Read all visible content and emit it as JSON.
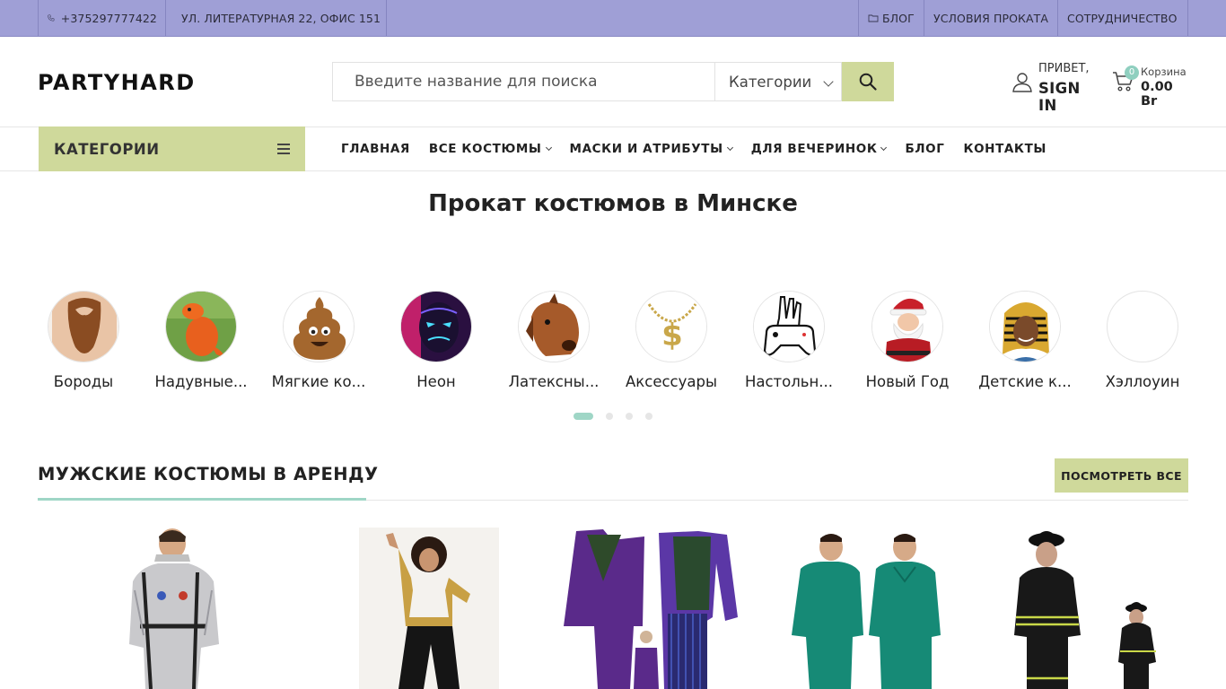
{
  "topbar": {
    "phone": "+375297777422",
    "address": "УЛ. ЛИТЕРАТУРНАЯ 22, ОФИС 151",
    "links": [
      "БЛОГ",
      "УСЛОВИЯ ПРОКАТА",
      "СОТРУДНИЧЕСТВО"
    ]
  },
  "header": {
    "logo": "PARTYHARD",
    "search_placeholder": "Введите название для поиска",
    "category_select": "Категории",
    "account_greeting": "ПРИВЕТ,",
    "account_signin": "SIGN IN",
    "cart_count": "0",
    "cart_label": "Корзина",
    "cart_total": "0.00 Br"
  },
  "nav": {
    "categories_label": "КАТЕГОРИИ",
    "items": [
      {
        "label": "ГЛАВНАЯ",
        "dropdown": false
      },
      {
        "label": "ВСЕ КОСТЮМЫ",
        "dropdown": true
      },
      {
        "label": "МАСКИ И АТРИБУТЫ",
        "dropdown": true
      },
      {
        "label": "ДЛЯ ВЕЧЕРИНОК",
        "dropdown": true
      },
      {
        "label": "БЛОГ",
        "dropdown": false
      },
      {
        "label": "КОНТАКТЫ",
        "dropdown": false
      }
    ]
  },
  "page_title": "Прокат костюмов в Минске",
  "categories": [
    {
      "name": "Бороды",
      "icon": "beard-icon"
    },
    {
      "name": "Надувные...",
      "icon": "inflatable-dino-icon"
    },
    {
      "name": "Мягкие ко...",
      "icon": "poop-costume-icon"
    },
    {
      "name": "Неон",
      "icon": "neon-mask-icon"
    },
    {
      "name": "Латексны...",
      "icon": "horse-mask-icon"
    },
    {
      "name": "Аксессуары",
      "icon": "dollar-chain-icon"
    },
    {
      "name": "Настольн...",
      "icon": "gamepad-hand-icon"
    },
    {
      "name": "Новый Год",
      "icon": "santa-icon"
    },
    {
      "name": "Детские к...",
      "icon": "pharaoh-kid-icon"
    },
    {
      "name": "Хэллоуин",
      "icon": "empty-image"
    }
  ],
  "carousel": {
    "pages": 4,
    "active_page": 1
  },
  "section": {
    "title": "МУЖСКИЕ КОСТЮМЫ В АРЕНДУ",
    "view_all": "ПОСМОТРЕТЬ ВСЕ"
  },
  "products": [
    {
      "image": "astronaut-costume"
    },
    {
      "image": "disco-costume"
    },
    {
      "image": "joker-costume"
    },
    {
      "image": "surgeon-gown-costume"
    },
    {
      "image": "firefighter-costume"
    }
  ],
  "colors": {
    "topbar_bg": "#9f9fd6",
    "accent_lime": "#cfd99b",
    "accent_mint": "#9fd6c6"
  }
}
